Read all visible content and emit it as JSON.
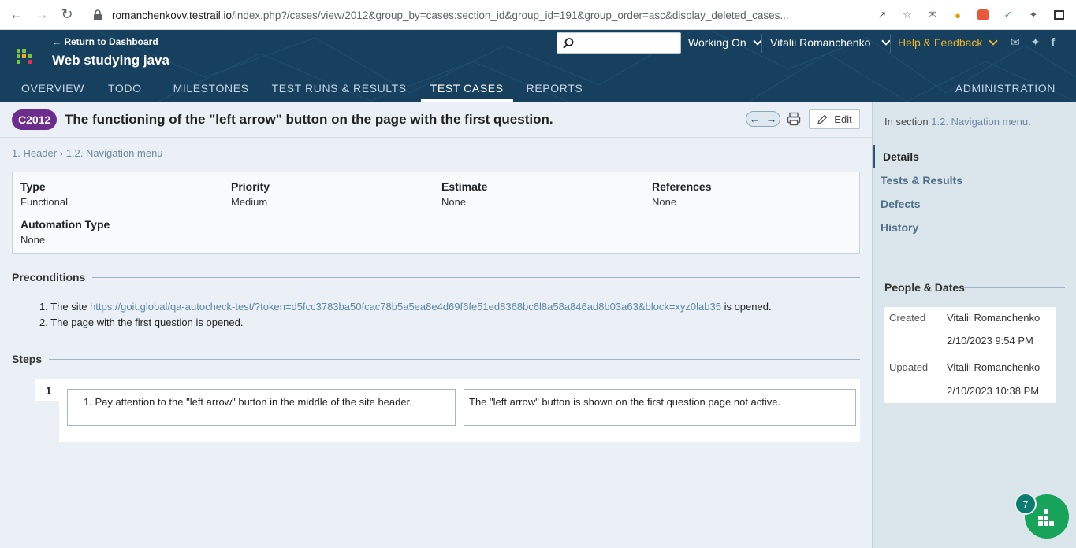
{
  "browser": {
    "url_host": "romanchenkovv.testrail.io",
    "url_path": "/index.php?/cases/view/2012&group_by=cases:section_id&group_id=191&group_order=asc&display_deleted_cases..."
  },
  "header": {
    "back_link": "← Return to Dashboard",
    "project_title": "Web studying java",
    "search_placeholder": "",
    "working_on": "Working On",
    "user": "Vitalii Romanchenko",
    "help": "Help & Feedback"
  },
  "tabs": [
    {
      "label": "OVERVIEW"
    },
    {
      "label": "TODO"
    },
    {
      "label": "MILESTONES"
    },
    {
      "label": "TEST RUNS & RESULTS"
    },
    {
      "label": "TEST CASES"
    },
    {
      "label": "REPORTS"
    }
  ],
  "admin_tab": "ADMINISTRATION",
  "case": {
    "id": "C2012",
    "title": "The functioning of the \"left arrow\" button on the page with the first question.",
    "edit_label": "Edit",
    "breadcrumb": {
      "parent": "1. Header",
      "sep": "›",
      "child": "1.2. Navigation menu"
    },
    "properties": [
      {
        "key": "Type",
        "value": "Functional"
      },
      {
        "key": "Priority",
        "value": "Medium"
      },
      {
        "key": "Estimate",
        "value": "None"
      },
      {
        "key": "References",
        "value": "None"
      },
      {
        "key": "Automation Type",
        "value": "None"
      }
    ],
    "preconditions_label": "Preconditions",
    "preconditions": {
      "item1_prefix": "1. The site ",
      "item1_link": "https://goit.global/qa-autocheck-test/?token=d5fcc3783ba50fcac78b5a5ea8e4d69f6fe51ed8368bc6l8a58a846ad8b03a63&block=xyz0lab35",
      "item1_suffix": " is opened.",
      "item2": "2. The page with the first question is opened."
    },
    "steps_label": "Steps",
    "steps": [
      {
        "number": "1",
        "action": "1. Pay attention to the \"left arrow\" button in the middle of the site header.",
        "expected": "The \"left arrow\" button is shown on the first question page not active."
      }
    ]
  },
  "sidebar": {
    "in_section_prefix": "In section ",
    "in_section_link": "1.2. Navigation menu",
    "in_section_suffix": ".",
    "nav": [
      {
        "label": "Details"
      },
      {
        "label": "Tests & Results"
      },
      {
        "label": "Defects"
      },
      {
        "label": "History"
      }
    ],
    "people_title": "People & Dates",
    "created_label": "Created",
    "created_by": "Vitalii Romanchenko",
    "created_on": "2/10/2023 9:54 PM",
    "updated_label": "Updated",
    "updated_by": "Vitalii Romanchenko",
    "updated_on": "2/10/2023 10:38 PM"
  },
  "fab_badge": "7",
  "colors": {
    "header_bg": "#16405e",
    "badge_purple": "#6d2d8c",
    "help_yellow": "#f0b429",
    "fab_green": "#17a35a"
  }
}
